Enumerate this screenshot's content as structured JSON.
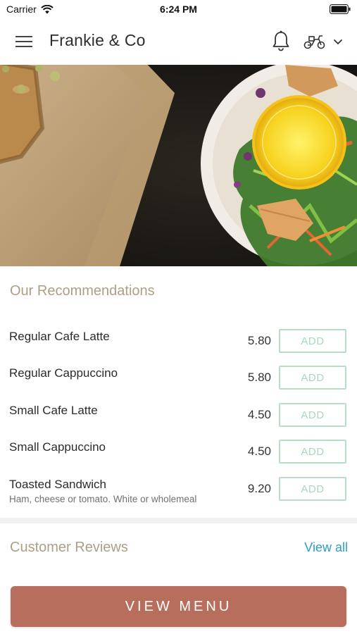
{
  "status_bar": {
    "carrier": "Carrier",
    "time": "6:24 PM",
    "wifi_icon": "wifi-icon",
    "battery_icon": "battery-icon"
  },
  "header": {
    "title": "Frankie & Co",
    "icons": [
      "hamburger-menu-icon",
      "bell-icon",
      "scooter-icon",
      "chevron-down-icon"
    ]
  },
  "hero": {
    "image": "food-plate-photo"
  },
  "recommendations": {
    "title": "Our Recommendations",
    "items": [
      {
        "name": "Regular Cafe Latte",
        "description": "",
        "price": "5.80",
        "add_label": "ADD"
      },
      {
        "name": "Regular Cappuccino",
        "description": "",
        "price": "5.80",
        "add_label": "ADD"
      },
      {
        "name": "Small Cafe Latte",
        "description": "",
        "price": "4.50",
        "add_label": "ADD"
      },
      {
        "name": "Small Cappuccino",
        "description": "",
        "price": "4.50",
        "add_label": "ADD"
      },
      {
        "name": "Toasted Sandwich",
        "description": "Ham, cheese or tomato. White or wholemeal",
        "price": "9.20",
        "add_label": "ADD"
      }
    ]
  },
  "reviews": {
    "title": "Customer Reviews",
    "view_all_label": "View all"
  },
  "footer": {
    "view_menu_label": "VIEW MENU"
  },
  "colors": {
    "accent_gold": "#ad9f84",
    "add_green": "#b5dec7",
    "link_blue": "#2a9fc9",
    "cta_terracotta": "#b86e5c"
  }
}
